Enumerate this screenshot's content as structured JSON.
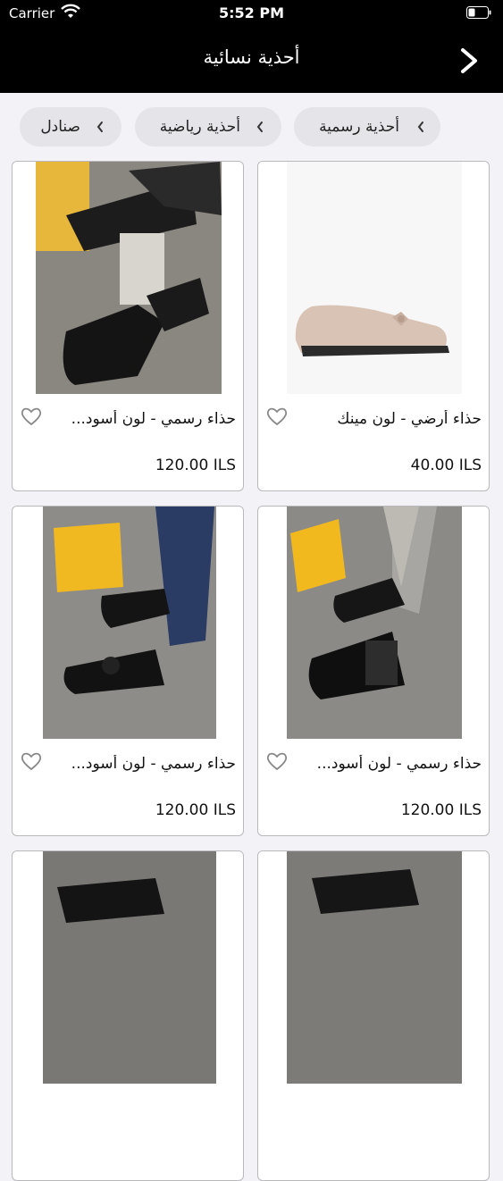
{
  "status_bar": {
    "carrier": "Carrier",
    "time": "5:52 PM"
  },
  "header": {
    "title": "أحذية نسائية",
    "back_icon": "chevron-right-icon"
  },
  "categories": [
    {
      "label": "أحذية رسمية"
    },
    {
      "label": "أحذية رياضية"
    },
    {
      "label": "صنادل"
    }
  ],
  "products": [
    {
      "name": "حذاء أرضي - لون مينك",
      "price": "40.00 ILS",
      "image": "beige-flat-shoe"
    },
    {
      "name": "حذاء رسمي - لون أسود...",
      "price": "120.00 ILS",
      "image": "black-loafers-with-box"
    },
    {
      "name": "حذاء رسمي - لون أسود...",
      "price": "120.00 ILS",
      "image": "black-patent-lace-up"
    },
    {
      "name": "حذاء رسمي - لون أسود...",
      "price": "120.00 ILS",
      "image": "black-bow-loafers"
    },
    {
      "name": "",
      "price": "",
      "image": "black-shoe"
    },
    {
      "name": "",
      "price": "",
      "image": "black-shoe"
    }
  ],
  "colors": {
    "bar": "#000000",
    "background": "#f2f2f7",
    "chip": "#e4e4e9"
  }
}
